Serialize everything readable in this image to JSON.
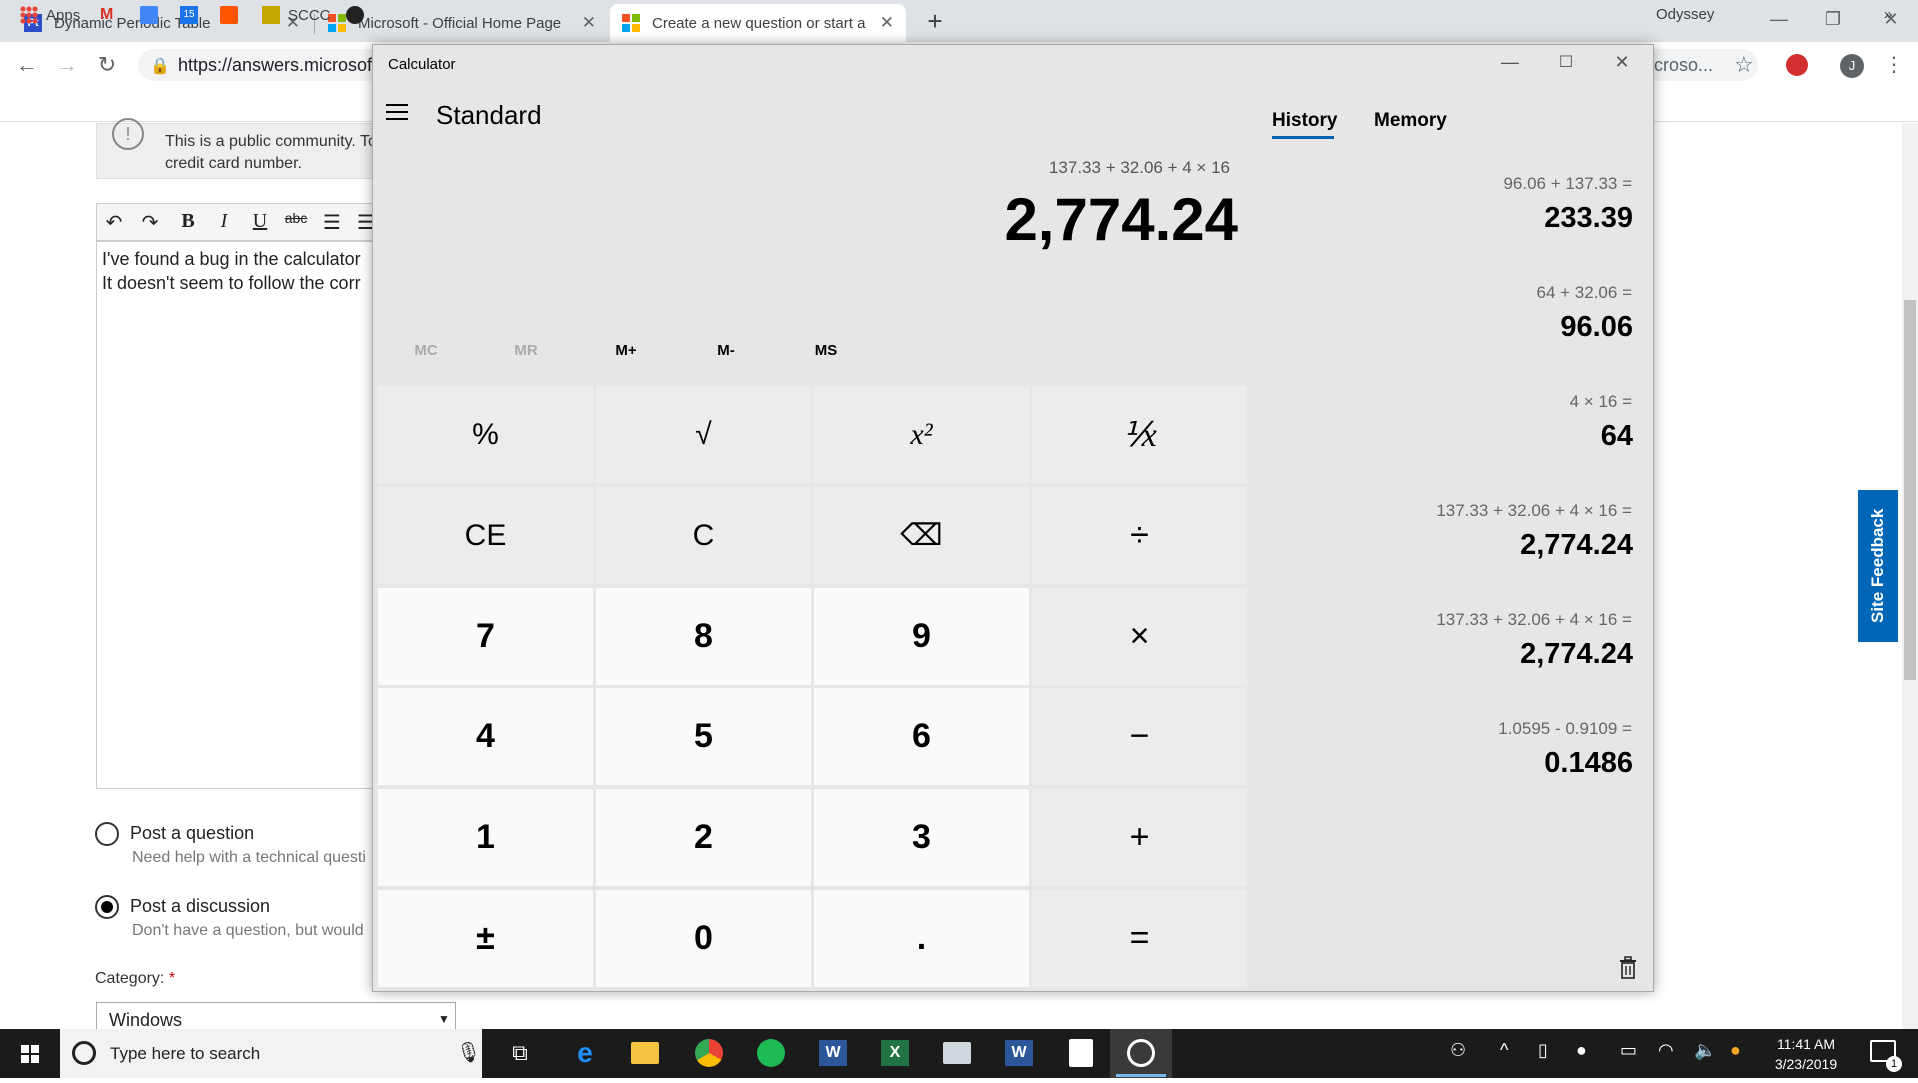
{
  "browser": {
    "tabs": [
      {
        "title": "Dynamic Periodic Table",
        "favicon": "pt-icon",
        "active": false
      },
      {
        "title": "Microsoft - Official Home Page",
        "favicon": "microsoft-logo-icon",
        "active": false
      },
      {
        "title": "Create a new question or start a",
        "favicon": "microsoft-logo-icon",
        "active": true
      }
    ],
    "url": "https://answers.microsoft",
    "url_tail": "icroso...",
    "bookmarks": [
      {
        "label": "Apps",
        "icon": "apps-grid-icon"
      },
      {
        "label": "",
        "icon": "gmail-icon"
      },
      {
        "label": "",
        "icon": "docs-icon"
      },
      {
        "label": "15",
        "icon": "calendar-icon"
      },
      {
        "label": "",
        "icon": "soundcloud-icon"
      },
      {
        "label": "SCCC",
        "icon": "sccc-icon"
      },
      {
        "label": "",
        "icon": "edge-like-icon"
      },
      {
        "label": "Odyssey",
        "icon": "odyssey-icon"
      }
    ],
    "bookmarks_more": "»",
    "profile_initial": "J"
  },
  "page": {
    "notice_line1": "This is a public community. To",
    "notice_line2": "credit card number.",
    "editor_line1": "I've found a bug in the calculator",
    "editor_line2": "It doesn't seem to follow the corr",
    "post_question_label": "Post a question",
    "post_question_sub": "Need help with a technical questi",
    "post_discussion_label": "Post a discussion",
    "post_discussion_sub": "Don't have a question, but would",
    "category_label": "Category:",
    "category_required": "*",
    "category_value": "Windows",
    "site_feedback": "Site Feedback"
  },
  "calculator": {
    "title": "Calculator",
    "mode": "Standard",
    "expression": "137.33  +  32.06  +  4  ×  16",
    "display": "2,774.24",
    "memory_buttons": [
      {
        "label": "MC",
        "enabled": false
      },
      {
        "label": "MR",
        "enabled": false
      },
      {
        "label": "M+",
        "enabled": true
      },
      {
        "label": "M-",
        "enabled": true
      },
      {
        "label": "MS",
        "enabled": true
      }
    ],
    "keys": [
      [
        "%",
        "√",
        "x²",
        "⅟x"
      ],
      [
        "CE",
        "C",
        "⌫",
        "÷"
      ],
      [
        "7",
        "8",
        "9",
        "×"
      ],
      [
        "4",
        "5",
        "6",
        "−"
      ],
      [
        "1",
        "2",
        "3",
        "+"
      ],
      [
        "±",
        "0",
        ".",
        "="
      ]
    ],
    "tabs": {
      "history": "History",
      "memory": "Memory"
    },
    "history": [
      {
        "expr": "96.06   +   137.33 =",
        "result": "233.39"
      },
      {
        "expr": "64   +   32.06 =",
        "result": "96.06"
      },
      {
        "expr": "4   ×   16 =",
        "result": "64"
      },
      {
        "expr": "137.33   +   32.06   +   4   ×   16 =",
        "result": "2,774.24"
      },
      {
        "expr": "137.33   +   32.06   +   4   ×   16 =",
        "result": "2,774.24"
      },
      {
        "expr": "1.0595   -   0.9109 =",
        "result": "0.1486"
      }
    ]
  },
  "taskbar": {
    "search_placeholder": "Type here to search",
    "time": "11:41 AM",
    "date": "3/23/2019",
    "notification_count": "1"
  }
}
